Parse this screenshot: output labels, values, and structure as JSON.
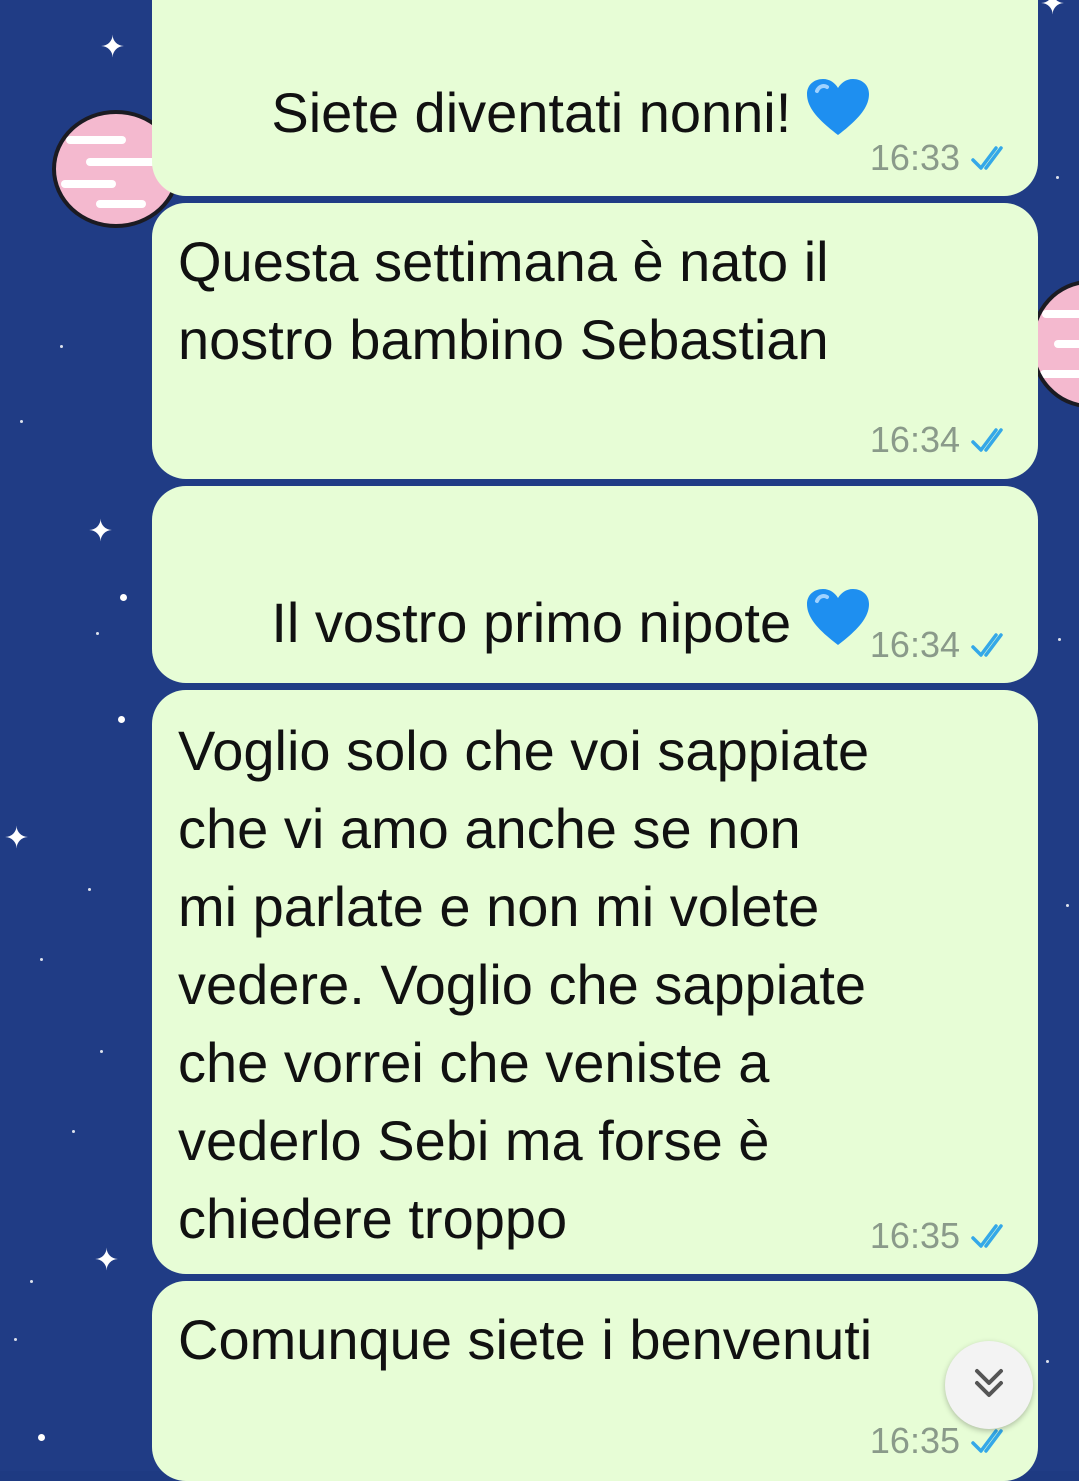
{
  "colors": {
    "wallpaper": "#203c85",
    "bubble": "#e7fdd6",
    "text": "#111111",
    "time": "#8a9a8a",
    "read_ticks": "#34a8e8",
    "heart": "#1e8ff0",
    "planet": "#f4b9cf"
  },
  "messages": [
    {
      "text": "Siete diventati nonni!",
      "emoji": "blue-heart",
      "time": "16:33",
      "status": "read"
    },
    {
      "text": "Questa settimana è nato il\nnostro bambino Sebastian",
      "emoji": "",
      "time": "16:34",
      "status": "read"
    },
    {
      "text": "Il vostro primo nipote",
      "emoji": "blue-heart",
      "time": "16:34",
      "status": "read"
    },
    {
      "text": "Voglio solo che voi sappiate\nche vi amo anche se non\nmi parlate e non mi volete\nvedere. Voglio che sappiate\nche vorrei che veniste a\nvederlo Sebi ma forse è\nchiedere troppo",
      "emoji": "",
      "time": "16:35",
      "status": "read"
    },
    {
      "text": "Comunque siete i benvenuti",
      "emoji": "",
      "time": "16:35",
      "status": "read"
    }
  ],
  "scroll_button": {
    "icon": "double-chevron-down-icon"
  }
}
